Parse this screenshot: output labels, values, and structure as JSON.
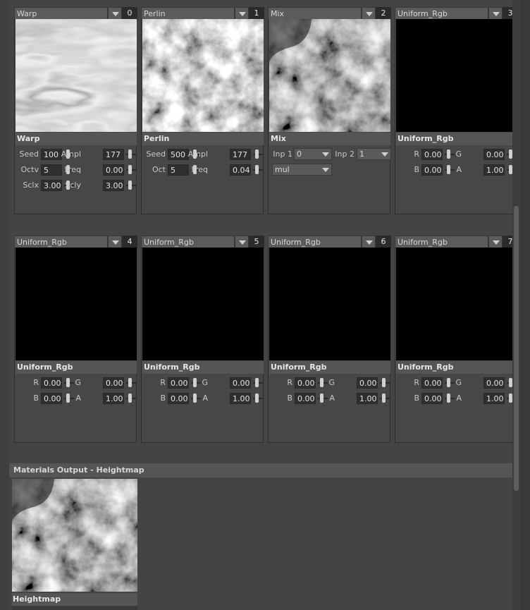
{
  "nodes": [
    {
      "type": "Warp",
      "index": "0",
      "title": "Warp",
      "preview": "warp",
      "params": [
        {
          "label": "Seed",
          "value": "100",
          "col": 0,
          "row": 0
        },
        {
          "label": "Ampl",
          "value": "177",
          "col": 1,
          "row": 0
        },
        {
          "label": "Octv",
          "value": "5",
          "col": 0,
          "row": 1
        },
        {
          "label": "Freq",
          "value": "0.00",
          "col": 1,
          "row": 1
        },
        {
          "label": "Sclx",
          "value": "3.00",
          "col": 0,
          "row": 2
        },
        {
          "label": "Scly",
          "value": "3.00",
          "col": 1,
          "row": 2
        }
      ]
    },
    {
      "type": "Perlin",
      "index": "1",
      "title": "Perlin",
      "preview": "perlin",
      "params": [
        {
          "label": "Seed",
          "value": "500",
          "col": 0,
          "row": 0
        },
        {
          "label": "Ampl",
          "value": "177",
          "col": 1,
          "row": 0
        },
        {
          "label": "Oct",
          "value": "5",
          "col": 0,
          "row": 1
        },
        {
          "label": "Freq",
          "value": "0.04",
          "col": 1,
          "row": 1
        }
      ]
    },
    {
      "type": "Mix",
      "index": "2",
      "title": "Mix",
      "preview": "mix",
      "inputs": {
        "inp1_label": "Inp 1",
        "inp1_value": "0",
        "inp2_label": "Inp 2",
        "inp2_value": "1",
        "mode": "mul"
      }
    },
    {
      "type": "Uniform_Rgb",
      "index": "3",
      "title": "Uniform_Rgb",
      "preview": "black",
      "params": [
        {
          "label": "R",
          "value": "0.00",
          "col": 0,
          "row": 0
        },
        {
          "label": "G",
          "value": "0.00",
          "col": 1,
          "row": 0
        },
        {
          "label": "B",
          "value": "0.00",
          "col": 0,
          "row": 1
        },
        {
          "label": "A",
          "value": "1.00",
          "col": 1,
          "row": 1
        }
      ]
    },
    {
      "type": "Uniform_Rgb",
      "index": "4",
      "title": "Uniform_Rgb",
      "preview": "black",
      "params": [
        {
          "label": "R",
          "value": "0.00",
          "col": 0,
          "row": 0
        },
        {
          "label": "G",
          "value": "0.00",
          "col": 1,
          "row": 0
        },
        {
          "label": "B",
          "value": "0.00",
          "col": 0,
          "row": 1
        },
        {
          "label": "A",
          "value": "1.00",
          "col": 1,
          "row": 1
        }
      ]
    },
    {
      "type": "Uniform_Rgb",
      "index": "5",
      "title": "Uniform_Rgb",
      "preview": "black",
      "params": [
        {
          "label": "R",
          "value": "0.00",
          "col": 0,
          "row": 0
        },
        {
          "label": "G",
          "value": "0.00",
          "col": 1,
          "row": 0
        },
        {
          "label": "B",
          "value": "0.00",
          "col": 0,
          "row": 1
        },
        {
          "label": "A",
          "value": "1.00",
          "col": 1,
          "row": 1
        }
      ]
    },
    {
      "type": "Uniform_Rgb",
      "index": "6",
      "title": "Uniform_Rgb",
      "preview": "black",
      "params": [
        {
          "label": "R",
          "value": "0.00",
          "col": 0,
          "row": 0
        },
        {
          "label": "G",
          "value": "0.00",
          "col": 1,
          "row": 0
        },
        {
          "label": "B",
          "value": "0.00",
          "col": 0,
          "row": 1
        },
        {
          "label": "A",
          "value": "1.00",
          "col": 1,
          "row": 1
        }
      ]
    },
    {
      "type": "Uniform_Rgb",
      "index": "7",
      "title": "Uniform_Rgb",
      "preview": "black",
      "params": [
        {
          "label": "R",
          "value": "0.00",
          "col": 0,
          "row": 0
        },
        {
          "label": "G",
          "value": "0.00",
          "col": 1,
          "row": 0
        },
        {
          "label": "B",
          "value": "0.00",
          "col": 0,
          "row": 1
        },
        {
          "label": "A",
          "value": "1.00",
          "col": 1,
          "row": 1
        }
      ]
    }
  ],
  "output": {
    "header": "Materials Output - Heightmap",
    "title": "Heightmap",
    "preview": "mix"
  }
}
